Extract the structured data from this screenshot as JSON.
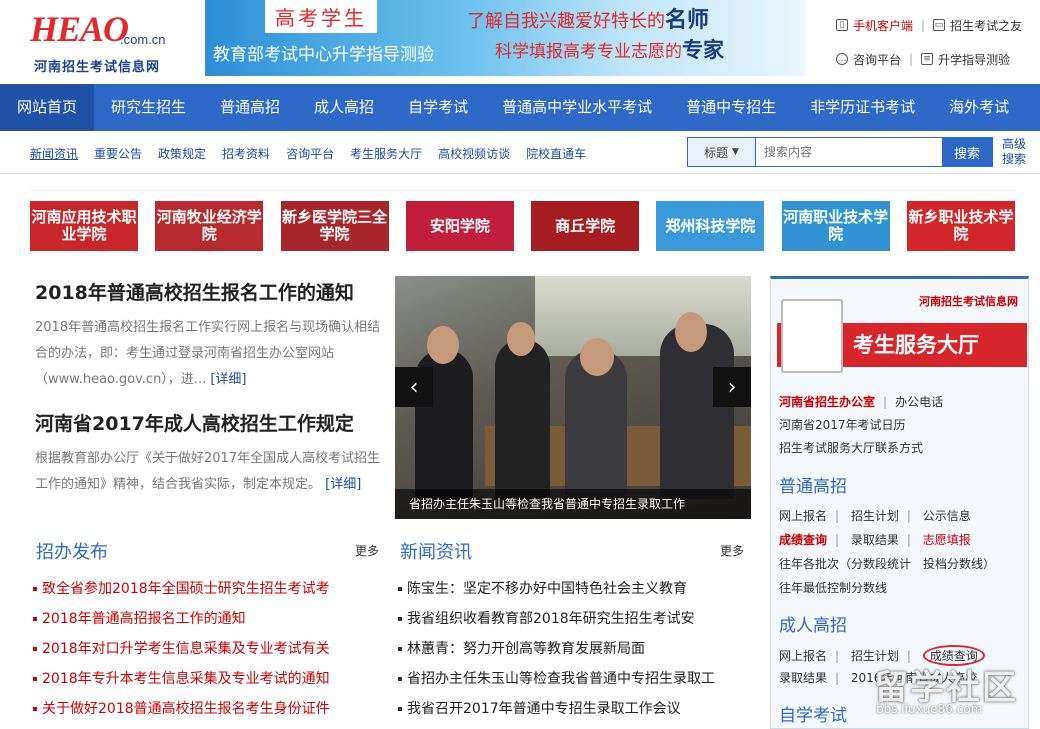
{
  "header": {
    "logo_mark": "HEAO",
    "logo_domain": ".com.cn",
    "logo_name": "河南招生考试信息网",
    "banner": {
      "tag": "高考学生",
      "line1": "了解自我兴趣爱好特长的",
      "line1_bold": "名师",
      "line2": "科学填报高考专业志愿的",
      "line2_bold": "专家",
      "sub": "教育部考试中心升学指导测验"
    },
    "top_links": {
      "mobile": "手机客户端",
      "exam_friend": "招生考试之友",
      "consult": "咨询平台",
      "guidance_test": "升学指导测验"
    }
  },
  "nav": {
    "items": [
      "网站首页",
      "研究生招生",
      "普通高招",
      "成人高招",
      "自学考试",
      "普通高中学业水平考试",
      "普通中专招生",
      "非学历证书考试",
      "海外考试"
    ]
  },
  "subnav": {
    "items": [
      "新闻资讯",
      "重要公告",
      "政策规定",
      "招考资料",
      "咨询平台",
      "考生服务大厅",
      "高校视频访谈",
      "院校直通车"
    ]
  },
  "search": {
    "scope": "标题",
    "placeholder": "搜索内容",
    "button": "搜索",
    "advanced": "高级搜索"
  },
  "schools": [
    {
      "name": "河南应用技术职业学院",
      "color": "#c8262b"
    },
    {
      "name": "河南牧业经济学院",
      "color": "#b92a2e"
    },
    {
      "name": "新乡医学院三全学院",
      "color": "#a8262b"
    },
    {
      "name": "安阳学院",
      "color": "#c01e3a"
    },
    {
      "name": "商丘学院",
      "color": "#a51d20"
    },
    {
      "name": "郑州科技学院",
      "color": "#3a9ad9"
    },
    {
      "name": "河南职业技术学院",
      "color": "#2f93d4"
    },
    {
      "name": "新乡职业技术学院",
      "color": "#d3262a"
    }
  ],
  "lead1": {
    "title": "2018年普通高校招生报名工作的通知",
    "body": "2018年普通高校招生报名工作实行网上报名与现场确认相结合的办法，即：考生通过登录河南省招生办公室网站（www.heao.gov.cn），进...",
    "more": "[详细]"
  },
  "lead2": {
    "title": "河南省2017年成人高校招生工作规定",
    "body": "根据教育部办公厅《关于做好2017年全国成人高校考试招生工作的通知》精神，结合我省实际，制定本规定。",
    "more": "[详细]"
  },
  "slide": {
    "caption": "省招办主任朱玉山等检查我省普通中专招生录取工作",
    "prev": "‹",
    "next": "›"
  },
  "zhaoban": {
    "title": "招办发布",
    "more": "更多",
    "items": [
      "致全省参加2018年全国硕士研究生招生考试考",
      "2018年普通高招报名工作的通知",
      "2018年对口升学考生信息采集及专业考试有关",
      "2018年专升本考生信息采集及专业考试的通知",
      "关于做好2018普通高校招生报名考生身份证件"
    ]
  },
  "news": {
    "title": "新闻资讯",
    "more": "更多",
    "items": [
      "陈宝生：坚定不移办好中国特色社会主义教育",
      "我省组织收看教育部2018年研究生招生考试安",
      "林蕙青：努力开创高等教育发展新局面",
      "省招办主任朱玉山等检查我省普通中专招生录取工",
      "我省召开2017年普通中专招生录取工作会议"
    ]
  },
  "service": {
    "site": "河南招生考试信息网",
    "hall": "考生服务大厅",
    "office": "河南省招生办公室",
    "phone": "办公电话",
    "calendar": "河南省2017年考试日历",
    "contact": "招生考试服务大厅联系方式",
    "general": {
      "title": "普通高招",
      "row1": [
        "网上报名",
        "招生计划",
        "公示信息"
      ],
      "row2": [
        "成绩查询",
        "录取结果",
        "志愿填报"
      ],
      "row3": "往年各批次（分数段统计　投档分数线）",
      "row4": "往年最低控制分数线"
    },
    "adult": {
      "title": "成人高招",
      "row1": [
        "网上报名",
        "招生计划",
        "成绩查询"
      ],
      "row2": [
        "录取结果",
        "2016年河南省成人高校"
      ]
    },
    "self": {
      "title": "自学考试"
    }
  },
  "watermark": {
    "brand": "留学社区",
    "url": "bbs.liuxue86.com"
  }
}
